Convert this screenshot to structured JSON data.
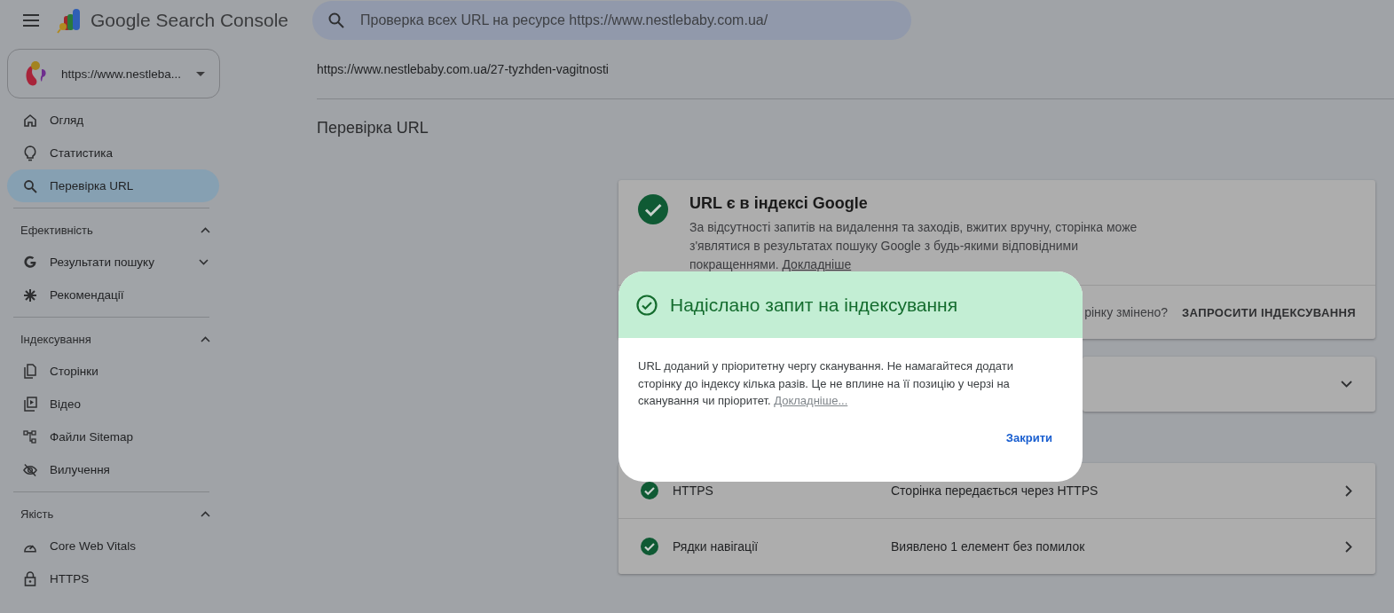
{
  "header": {
    "title": "Google Search Console",
    "search_placeholder": "Проверка всех URL на ресурсе https://www.nestlebaby.com.ua/"
  },
  "property": {
    "url": "https://www.nestleba..."
  },
  "nav_items": [
    {
      "label": "Огляд",
      "selected": false
    },
    {
      "label": "Статистика",
      "selected": false
    },
    {
      "label": "Перевірка URL",
      "selected": true
    }
  ],
  "nav_sections": [
    {
      "title": "Ефективність",
      "expanded": true,
      "items": [
        {
          "label": "Результати пошуку",
          "selected": false,
          "expanded": false
        },
        {
          "label": "Рекомендації",
          "selected": false
        }
      ]
    },
    {
      "title": "Індексування",
      "expanded": true,
      "items": [
        {
          "label": "Сторінки",
          "selected": false
        },
        {
          "label": "Відео",
          "selected": false
        },
        {
          "label": "Файли Sitemap",
          "selected": false
        },
        {
          "label": "Вилучення",
          "selected": false
        }
      ]
    },
    {
      "title": "Якість",
      "expanded": true,
      "items": [
        {
          "label": "Core Web Vitals",
          "selected": false
        },
        {
          "label": "HTTPS",
          "selected": false
        }
      ]
    }
  ],
  "page_url": "https://www.nestlebaby.com.ua/27-tyzhden-vagitnosti",
  "page_title": "Перевірка URL",
  "index_card": {
    "title": "URL є в індексі Google",
    "description": "За відсутності запитів на видалення та заходів, вжитих вручну, сторінка може з'являтися в результатах пошуку Google з будь-якими відповідними покращеннями.",
    "link": "Докладніше",
    "question": "рінку змінено?",
    "request_button": "ЗАПРОСИТИ ІНДЕКСУВАННЯ"
  },
  "rows": [
    {
      "label": "HTTPS",
      "value": "Сторінка передається через HTTPS"
    },
    {
      "label": "Рядки навігації",
      "value": "Виявлено 1 елемент без помилок"
    }
  ],
  "dialog": {
    "title": "Надіслано запит на індексування",
    "body": "URL доданий у пріоритетну чергу сканування. Не намагайтеся додати сторінку до індексу кілька разів. Це не вплине на її позицію у черзі на сканування чи пріоритет.",
    "link": "Докладніше...",
    "close_button": "Закрити"
  }
}
